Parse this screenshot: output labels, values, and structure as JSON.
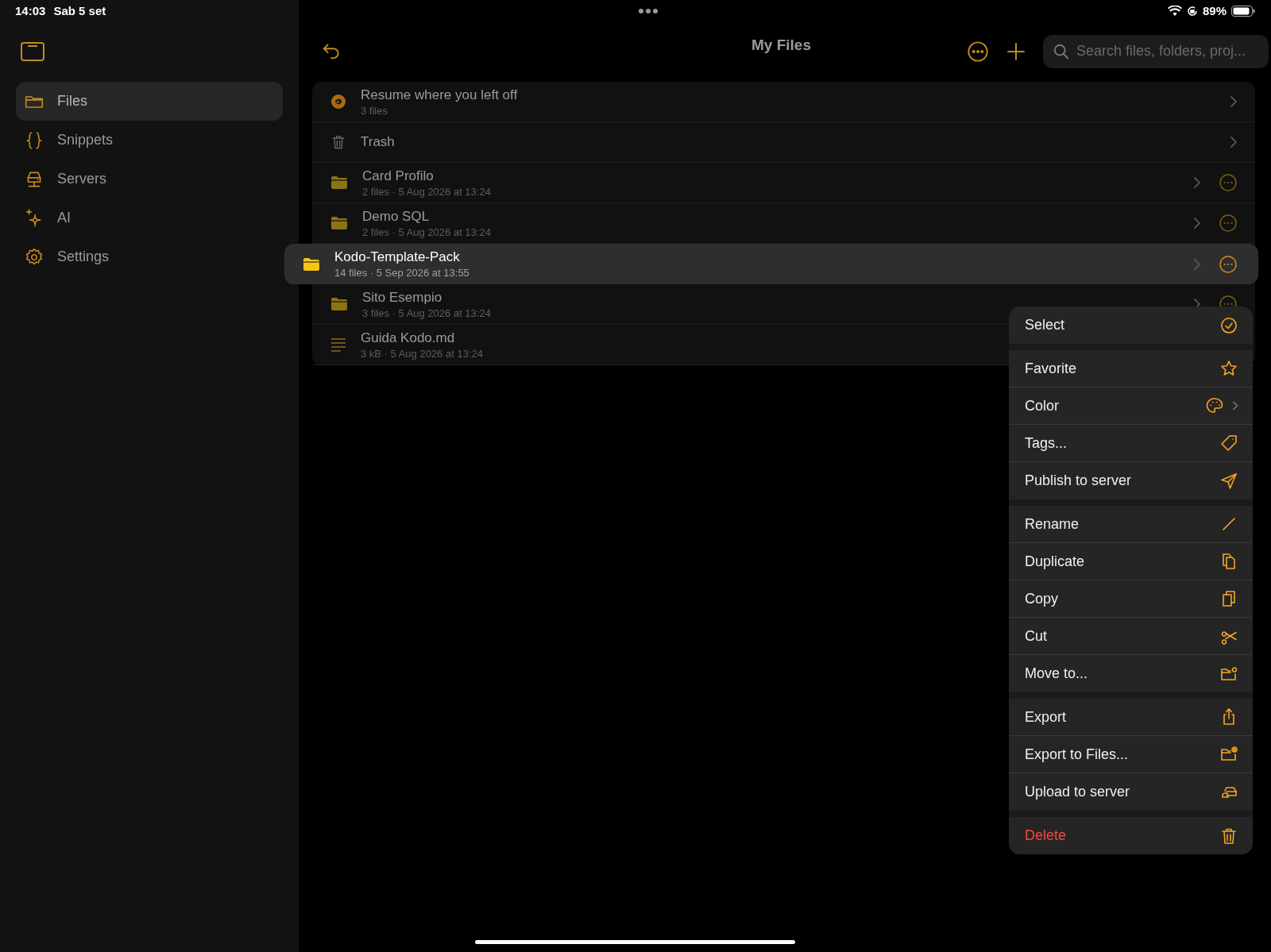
{
  "status_bar": {
    "time": "14:03",
    "date": "Sab 5 set",
    "battery": "89%"
  },
  "sidebar": {
    "items": [
      {
        "label": "Files",
        "kind": "folder",
        "selected": true
      },
      {
        "label": "Snippets",
        "kind": "braces",
        "selected": false
      },
      {
        "label": "Servers",
        "kind": "server",
        "selected": false
      },
      {
        "label": "AI",
        "kind": "sparkle",
        "selected": false
      },
      {
        "label": "Settings",
        "kind": "gear",
        "selected": false
      }
    ]
  },
  "header": {
    "title": "My Files",
    "search": {
      "placeholder": "Search files, folders, proj..."
    }
  },
  "rows": [
    {
      "kind": "resume",
      "name": "Resume where you left off",
      "meta": "3 files",
      "more": false,
      "selected": false
    },
    {
      "kind": "trash",
      "name": "Trash",
      "more": false,
      "selected": false
    },
    {
      "kind": "folder",
      "name": "Card Profilo",
      "meta": "2 files · 5 Aug 2026 at 13:24",
      "more": true,
      "selected": false
    },
    {
      "kind": "folder",
      "name": "Demo SQL",
      "meta": "2 files · 5 Aug 2026 at 13:24",
      "more": true,
      "selected": false
    },
    {
      "kind": "folder",
      "name": "Kodo-Template-Pack",
      "meta": "14 files · 5 Sep 2026 at 13:55",
      "more": true,
      "selected": true
    },
    {
      "kind": "folder",
      "name": "Sito Esempio",
      "meta": "3 files · 5 Aug 2026 at 13:24",
      "more": true,
      "selected": false
    },
    {
      "kind": "document",
      "name": "Guida Kodo.md",
      "meta": "3 kB · 5 Aug 2026 at 13:24",
      "more": false,
      "selected": false
    }
  ],
  "context_menu": {
    "groups": [
      [
        {
          "label": "Select",
          "kind": "select"
        }
      ],
      [
        {
          "label": "Favorite",
          "kind": "favorite"
        },
        {
          "label": "Color",
          "kind": "color",
          "submenu": true
        },
        {
          "label": "Tags...",
          "kind": "tags"
        },
        {
          "label": "Publish to server",
          "kind": "publish"
        }
      ],
      [
        {
          "label": "Rename",
          "kind": "rename"
        },
        {
          "label": "Duplicate",
          "kind": "duplicate"
        },
        {
          "label": "Copy",
          "kind": "copy"
        },
        {
          "label": "Cut",
          "kind": "cut"
        },
        {
          "label": "Move to...",
          "kind": "move"
        }
      ],
      [
        {
          "label": "Export",
          "kind": "export"
        },
        {
          "label": "Export to Files...",
          "kind": "export_files"
        },
        {
          "label": "Upload to server",
          "kind": "upload"
        }
      ],
      [
        {
          "label": "Delete",
          "kind": "delete",
          "destructive": true
        }
      ]
    ]
  }
}
